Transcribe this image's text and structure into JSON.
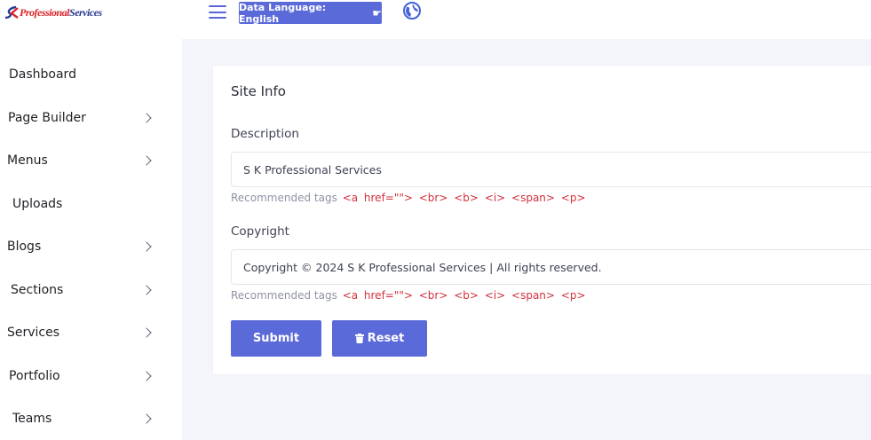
{
  "brand": {
    "logo_text_red": "Professional",
    "logo_text_blue": "Services"
  },
  "sidebar": {
    "items": [
      {
        "label": "Dashboard",
        "has_children": false
      },
      {
        "label": "Page Builder",
        "has_children": true
      },
      {
        "label": "Menus",
        "has_children": true
      },
      {
        "label": "Uploads",
        "has_children": false
      },
      {
        "label": "Blogs",
        "has_children": true
      },
      {
        "label": "Sections",
        "has_children": true
      },
      {
        "label": "Services",
        "has_children": true
      },
      {
        "label": "Portfolio",
        "has_children": true
      },
      {
        "label": "Teams",
        "has_children": true
      }
    ]
  },
  "topbar": {
    "language_button": "Data Language: English",
    "language_icon": "pointing-hand-icon",
    "globe_icon": "globe-icon",
    "menu_icon": "hamburger-icon"
  },
  "form": {
    "title": "Site Info",
    "description_label": "Description",
    "description_value": "S K Professional Services",
    "copyright_label": "Copyright",
    "copyright_value": "Copyright © 2024 S K Professional Services | All rights reserved.",
    "hint_text": "Recommended tags",
    "hint_tags": "<a href=\"\"> <br> <b> <i> <span> <p>",
    "submit_label": "Submit",
    "reset_label": "Reset",
    "reset_icon": "trash-icon"
  },
  "colors": {
    "accent": "#5b6ad9",
    "tag_red": "#d1313d",
    "background": "#f4f5fa"
  }
}
